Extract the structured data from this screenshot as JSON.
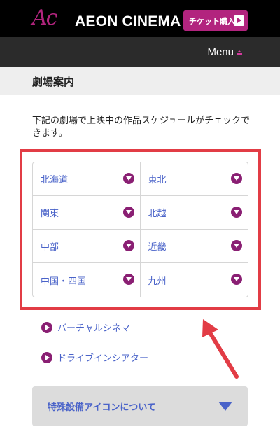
{
  "header": {
    "logo_mark": "Ac",
    "logo_text": "AEON CINEMA",
    "ticket_button": "チケット購入",
    "menu_label": "Menu"
  },
  "section": {
    "title": "劇場案内",
    "intro": "下記の劇場で上映中の作品スケジュールがチェックできます。"
  },
  "regions": [
    "北海道",
    "東北",
    "関東",
    "北越",
    "中部",
    "近畿",
    "中国・四国",
    "九州"
  ],
  "links": {
    "virtual": "バーチャルシネマ",
    "drivein": "ドライブインシアター"
  },
  "facility": {
    "label": "特殊設備アイコンについて"
  },
  "colors": {
    "brand": "#b2247e",
    "toggle": "#8a1f73",
    "link": "#4a63c9",
    "annotation": "#e23c45"
  }
}
